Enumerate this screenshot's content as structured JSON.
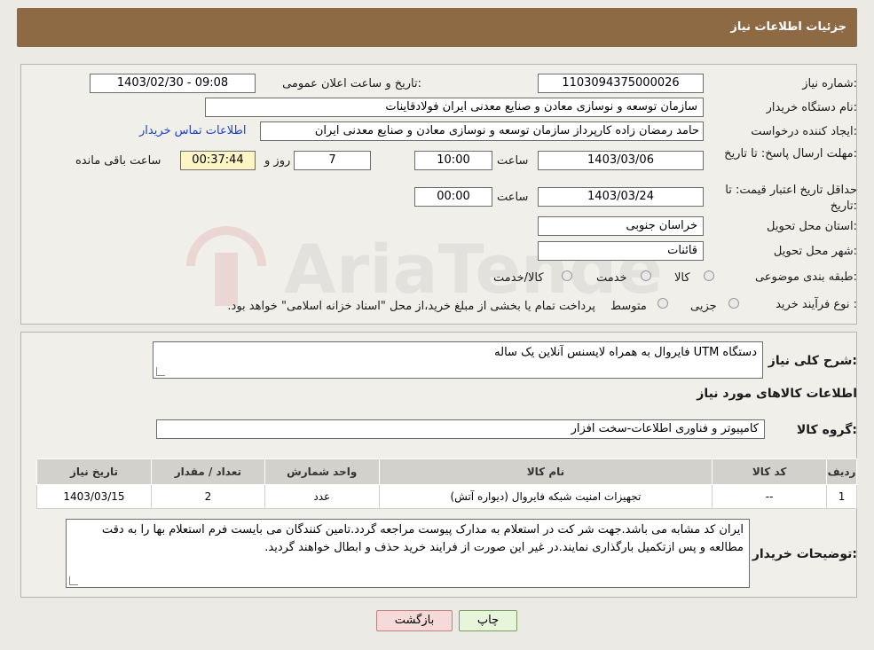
{
  "header": {
    "title": "جزئیات اطلاعات نیاز"
  },
  "form": {
    "need_number_label": "شماره نیاز:",
    "need_number": "1103094375000026",
    "announce_label": "تاریخ و ساعت اعلان عمومی:",
    "announce_value": "1403/02/30 - 09:08",
    "buyer_org_label": "نام دستگاه خریدار:",
    "buyer_org": "سازمان توسعه و نوسازی معادن و صنایع معدنی ایران فولادقاینات",
    "creator_label": "ایجاد کننده درخواست:",
    "creator": "حامد  رمضان زاده  کارپرداز  سازمان توسعه و نوسازی معادن و صنایع معدنی ایران",
    "contact_link": "اطلاعات تماس خریدار",
    "deadline_label": "مهلت ارسال پاسخ: تا تاریخ:",
    "deadline_date": "1403/03/06",
    "time_label": "ساعت",
    "deadline_time": "10:00",
    "days": "7",
    "days_label": "روز و",
    "remaining": "00:37:44",
    "remaining_label": "ساعت باقی مانده",
    "validity_label": "حداقل تاریخ اعتبار قیمت: تا تاریخ:",
    "validity_date": "1403/03/24",
    "validity_time": "00:00",
    "province_label": "استان محل تحویل:",
    "province": "خراسان جنوبی",
    "city_label": "شهر محل تحویل:",
    "city": "قائنات",
    "category_label": "طبقه بندی موضوعی:",
    "category_options": [
      "کالا",
      "خدمت",
      "کالا/خدمت"
    ],
    "process_label": "نوع فرآیند خرید :",
    "process_options": [
      "جزیی",
      "متوسط"
    ],
    "payment_note": "پرداخت تمام یا بخشی از مبلغ خرید،از محل \"اسناد خزانه اسلامی\" خواهد بود."
  },
  "details": {
    "summary_label": "شرح کلی نیاز:",
    "summary": "دستگاه UTM فایروال به همراه لایسنس آنلاین یک ساله",
    "goods_info_title": "اطلاعات کالاهای مورد نیاز",
    "group_label": "گروه کالا:",
    "group": "کامپیوتر و فناوری اطلاعات-سخت افزار",
    "table": {
      "headers": [
        "ردیف",
        "کد کالا",
        "نام کالا",
        "واحد شمارش",
        "تعداد / مقدار",
        "تاریخ نیاز"
      ],
      "rows": [
        [
          "1",
          "--",
          "تجهیزات امنیت شبکه فایروال (دیواره آتش)",
          "عدد",
          "2",
          "1403/03/15"
        ]
      ]
    },
    "buyer_notes_label": "توضیحات خریدار:",
    "buyer_notes": "ایران کد مشابه می باشد.جهت شر کت در استعلام به مدارک پیوست مراجعه گردد.تامین کنندگان می بایست فرم استعلام بها را به دقت مطالعه و پس ازتکمیل بارگذاری نمایند.در غیر این صورت از فرایند خرید حذف و ابطال خواهند گردید."
  },
  "buttons": {
    "print": "چاپ",
    "back": "بازگشت"
  },
  "watermark": "AriaTender.neT"
}
